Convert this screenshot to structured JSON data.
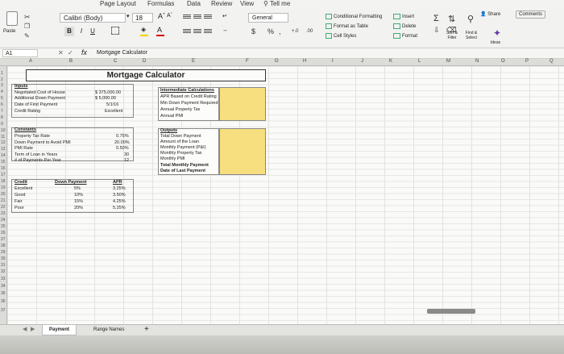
{
  "menu": [
    "Page Layout",
    "Formulas",
    "Data",
    "Review",
    "View",
    "Tell me"
  ],
  "ribbon": {
    "paste": "Paste",
    "font_name": "Calibri (Body)",
    "font_size": "18",
    "bold": "B",
    "italic": "I",
    "underline": "U",
    "number_format": "General",
    "currency": "$",
    "percent": "%",
    "comma": ",",
    "cond_format": "Conditional Formatting",
    "format_table": "Format as Table",
    "cell_styles": "Cell Styles",
    "insert": "Insert",
    "delete": "Delete",
    "format": "Format",
    "sort_filter": "Sort & Filter",
    "find_select": "Find & Select",
    "ideas": "Ideas",
    "share": "Share",
    "comments": "Comments"
  },
  "formula_bar": {
    "name_box": "A1",
    "fx": "fx",
    "value": "Mortgage Calculator"
  },
  "columns": [
    "A",
    "B",
    "C",
    "D",
    "E",
    "F",
    "G",
    "H",
    "I",
    "J",
    "K",
    "L",
    "M",
    "N",
    "O",
    "P",
    "Q"
  ],
  "rows": [
    "1",
    "2",
    "3",
    "4",
    "5",
    "6",
    "7",
    "8",
    "9",
    "10",
    "11",
    "12",
    "13",
    "14",
    "15",
    "16",
    "17",
    "18",
    "19",
    "20",
    "21",
    "22",
    "23",
    "24",
    "25",
    "26",
    "27",
    "28",
    "29",
    "30",
    "31",
    "32",
    "33",
    "34",
    "35",
    "36",
    "37"
  ],
  "sheet_title": "Mortgage Calculator",
  "inputs": {
    "header": "Inputs",
    "rows": [
      {
        "label": "Negotiated Cost of House",
        "value": "$ 375,000.00"
      },
      {
        "label": "Additional Down Payment",
        "value": "$ 5,000.00"
      },
      {
        "label": "Date of First Payment",
        "value": "5/1/16"
      },
      {
        "label": "Credit Rating",
        "value": "Excellent"
      }
    ]
  },
  "constants": {
    "header": "Constants",
    "rows": [
      {
        "label": "Property Tax Rate",
        "value": "0.75%"
      },
      {
        "label": "Down Payment to Avoid PMI",
        "value": "20.00%"
      },
      {
        "label": "PMI Rate",
        "value": "0.50%"
      },
      {
        "label": "Term of Loan in Years",
        "value": "30"
      },
      {
        "label": "# of Payments Per Year",
        "value": "12"
      }
    ]
  },
  "credit_table": {
    "headers": [
      "Credit",
      "Down Payment",
      "APR"
    ],
    "rows": [
      [
        "Excellent",
        "5%",
        "3.25%"
      ],
      [
        "Good",
        "10%",
        "3.50%"
      ],
      [
        "Fair",
        "15%",
        "4.25%"
      ],
      [
        "Poor",
        "20%",
        "5.25%"
      ]
    ]
  },
  "intermediate": {
    "header": "Intermediate Calculations",
    "rows": [
      "APR Based on Credit Rating",
      "Min Down Payment Required",
      "Annual Property Tax",
      "Annual PMI"
    ]
  },
  "outputs": {
    "header": "Outputs",
    "rows": [
      "Total Down Payment",
      "Amount of the Loan",
      "Monthly Payment (P&I)",
      "Monthly Property Tax",
      "Monthly PMI",
      "Total Monthly Payment",
      "Date of Last Payment"
    ]
  },
  "tabs": [
    "Payment",
    "Range Names"
  ],
  "add_tab": "+"
}
